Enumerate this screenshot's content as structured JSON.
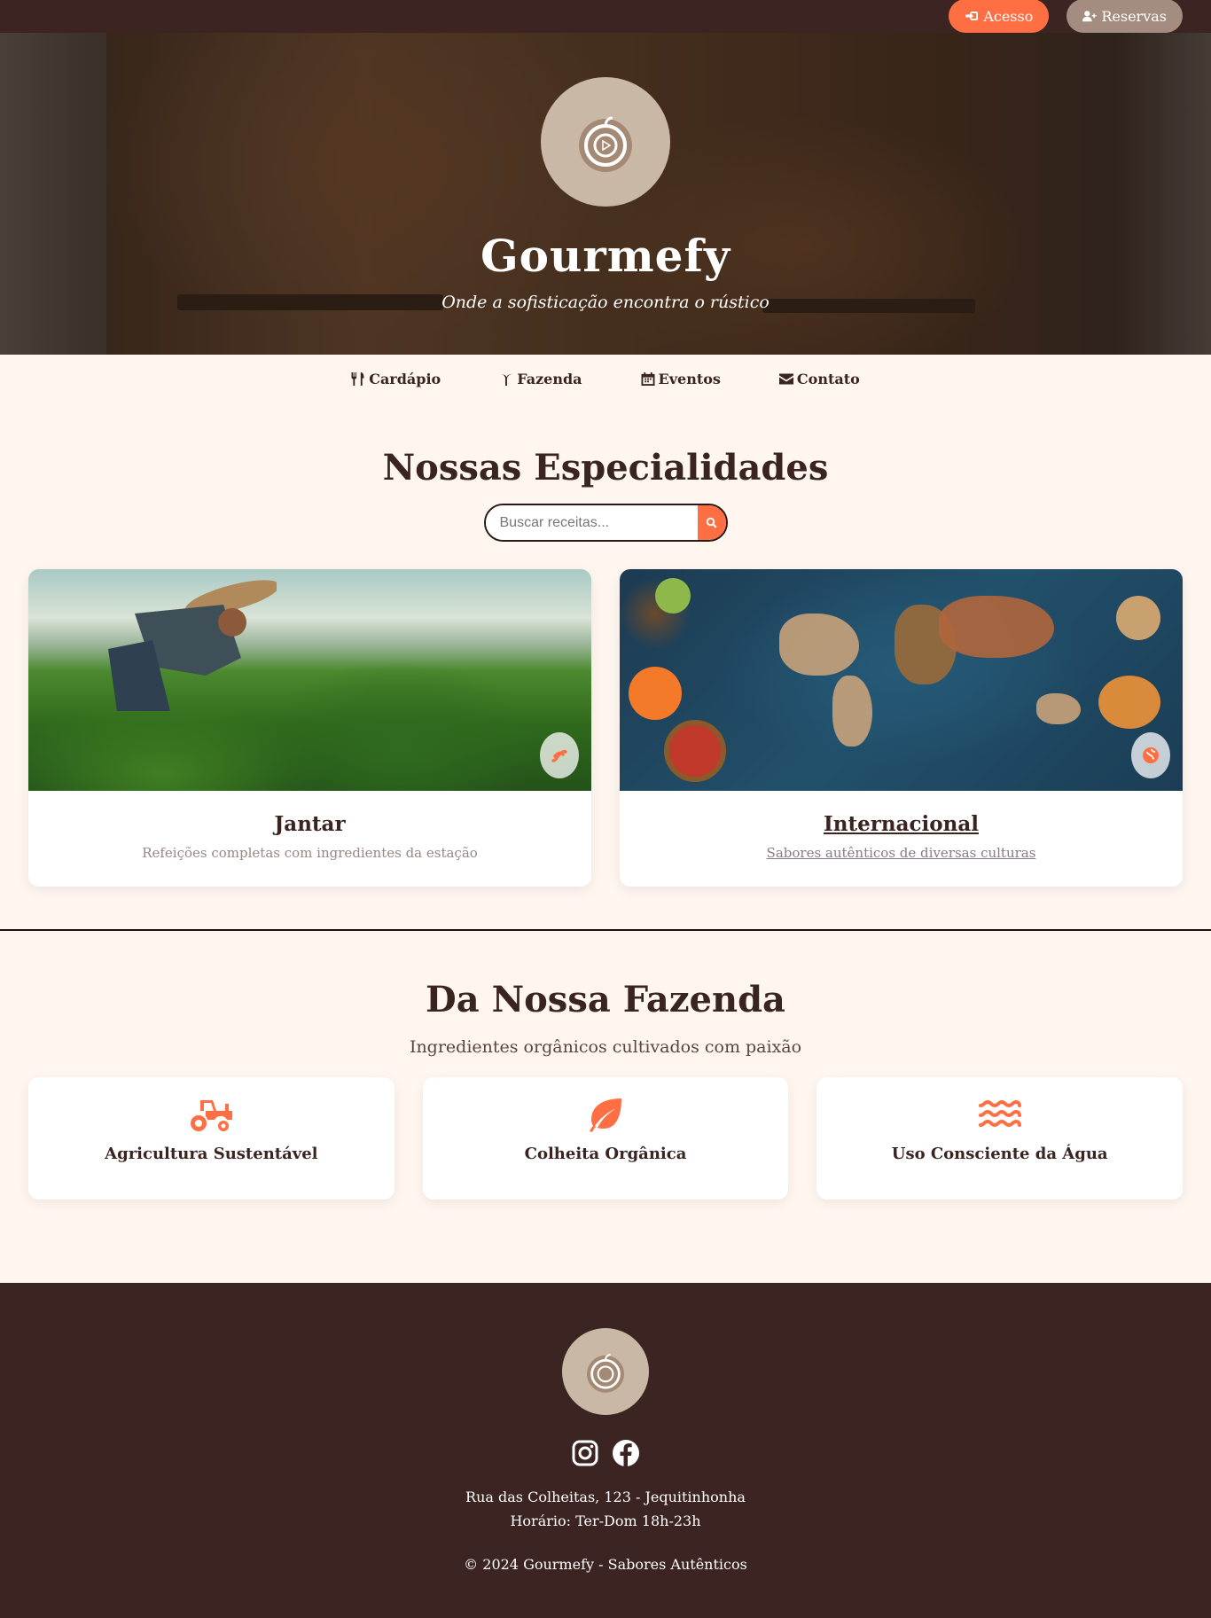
{
  "top_actions": {
    "login_label": "Acesso",
    "reservations_label": "Reservas"
  },
  "hero": {
    "title": "Gourmefy",
    "tagline": "Onde a sofisticação encontra o rústico"
  },
  "nav": [
    {
      "label": "Cardápio",
      "icon": "utensils-icon"
    },
    {
      "label": "Fazenda",
      "icon": "seedling-icon"
    },
    {
      "label": "Eventos",
      "icon": "calendar-icon"
    },
    {
      "label": "Contato",
      "icon": "envelope-icon"
    }
  ],
  "specialties": {
    "title": "Nossas Especialidades",
    "search_placeholder": "Buscar receitas...",
    "cards": [
      {
        "title": "Jantar",
        "description": "Refeições completas com ingredientes da estação",
        "icon": "scribble-icon"
      },
      {
        "title": "Internacional",
        "description": "Sabores autênticos de diversas culturas",
        "icon": "globe-icon"
      }
    ]
  },
  "farm": {
    "title": "Da Nossa Fazenda",
    "subtitle": "Ingredientes orgânicos cultivados com paixão",
    "features": [
      {
        "label": "Agricultura Sustentável",
        "icon": "tractor-icon"
      },
      {
        "label": "Colheita Orgânica",
        "icon": "leaf-icon"
      },
      {
        "label": "Uso Consciente da Água",
        "icon": "water-icon"
      }
    ]
  },
  "footer": {
    "address": "Rua das Colheitas, 123 - Jequitinhonha",
    "hours": "Horário: Ter-Dom 18h-23h",
    "copyright": "© 2024 Gourmefy - Sabores Autênticos",
    "socials": [
      "instagram-icon",
      "facebook-icon"
    ]
  },
  "colors": {
    "accent": "#ff6f43",
    "dark": "#3b2421",
    "background": "#fff6f0",
    "muted_button": "#a48d80"
  }
}
